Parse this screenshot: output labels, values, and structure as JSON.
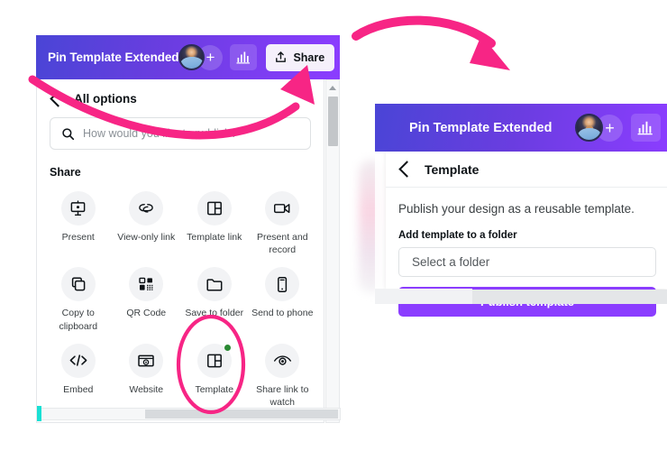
{
  "left_window": {
    "header": {
      "doc_title": "Pin Template Extended",
      "avatar_icon": "user-avatar",
      "add_member_label": "+",
      "analytics_icon": "bar-chart-icon",
      "share_label": "Share",
      "share_icon": "upload-arrow-icon",
      "gradient_from": "#4a45d6",
      "gradient_to": "#8b3dff"
    },
    "panel": {
      "back_icon": "chevron-left-icon",
      "title": "All options",
      "search_icon": "search-icon",
      "search_value": "",
      "search_placeholder": "How would you like to publish?",
      "section_label": "Share",
      "options": [
        {
          "label": "Present",
          "icon": "present-screen-icon",
          "badge": false
        },
        {
          "label": "View-only link",
          "icon": "link-chain-icon",
          "badge": false
        },
        {
          "label": "Template link",
          "icon": "template-layout-icon",
          "badge": false
        },
        {
          "label": "Present and record",
          "icon": "video-camera-icon",
          "badge": false
        },
        {
          "label": "Copy to clipboard",
          "icon": "copy-icon",
          "badge": false
        },
        {
          "label": "QR Code",
          "icon": "qr-code-icon",
          "badge": false
        },
        {
          "label": "Save to folder",
          "icon": "folder-icon",
          "badge": false
        },
        {
          "label": "Send to phone",
          "icon": "mobile-phone-icon",
          "badge": false
        },
        {
          "label": "Embed",
          "icon": "code-brackets-icon",
          "badge": false
        },
        {
          "label": "Website",
          "icon": "website-icon",
          "badge": false
        },
        {
          "label": "Template",
          "icon": "template-layout-icon",
          "badge": true
        },
        {
          "label": "Share link to watch",
          "icon": "eye-icon",
          "badge": false
        }
      ]
    },
    "scrollbar": {
      "up_arrow_icon": "triangle-up-icon",
      "down_arrow_icon": "triangle-down-icon"
    }
  },
  "right_window": {
    "header": {
      "doc_title": "Pin Template Extended",
      "avatar_icon": "user-avatar",
      "add_member_label": "+",
      "analytics_icon": "bar-chart-icon"
    },
    "panel": {
      "back_icon": "chevron-left-icon",
      "title": "Template",
      "description": "Publish your design as a reusable template.",
      "field_label": "Add template to a folder",
      "folder_select_value": "Select a folder",
      "publish_label": "Publish template"
    }
  },
  "annotations": {
    "accent_color": "#f72585",
    "arrow_top": "curved-arrow-right-icon",
    "arrow_share": "curved-arrow-to-share-icon",
    "highlight_ellipse": "template-highlight-ellipse"
  },
  "colors": {
    "brand_purple": "#8b3dff",
    "brand_blue": "#4a45d6",
    "pink_accent": "#f72585",
    "badge_green": "#2a8a33",
    "teal_marker": "#19e0d4"
  }
}
